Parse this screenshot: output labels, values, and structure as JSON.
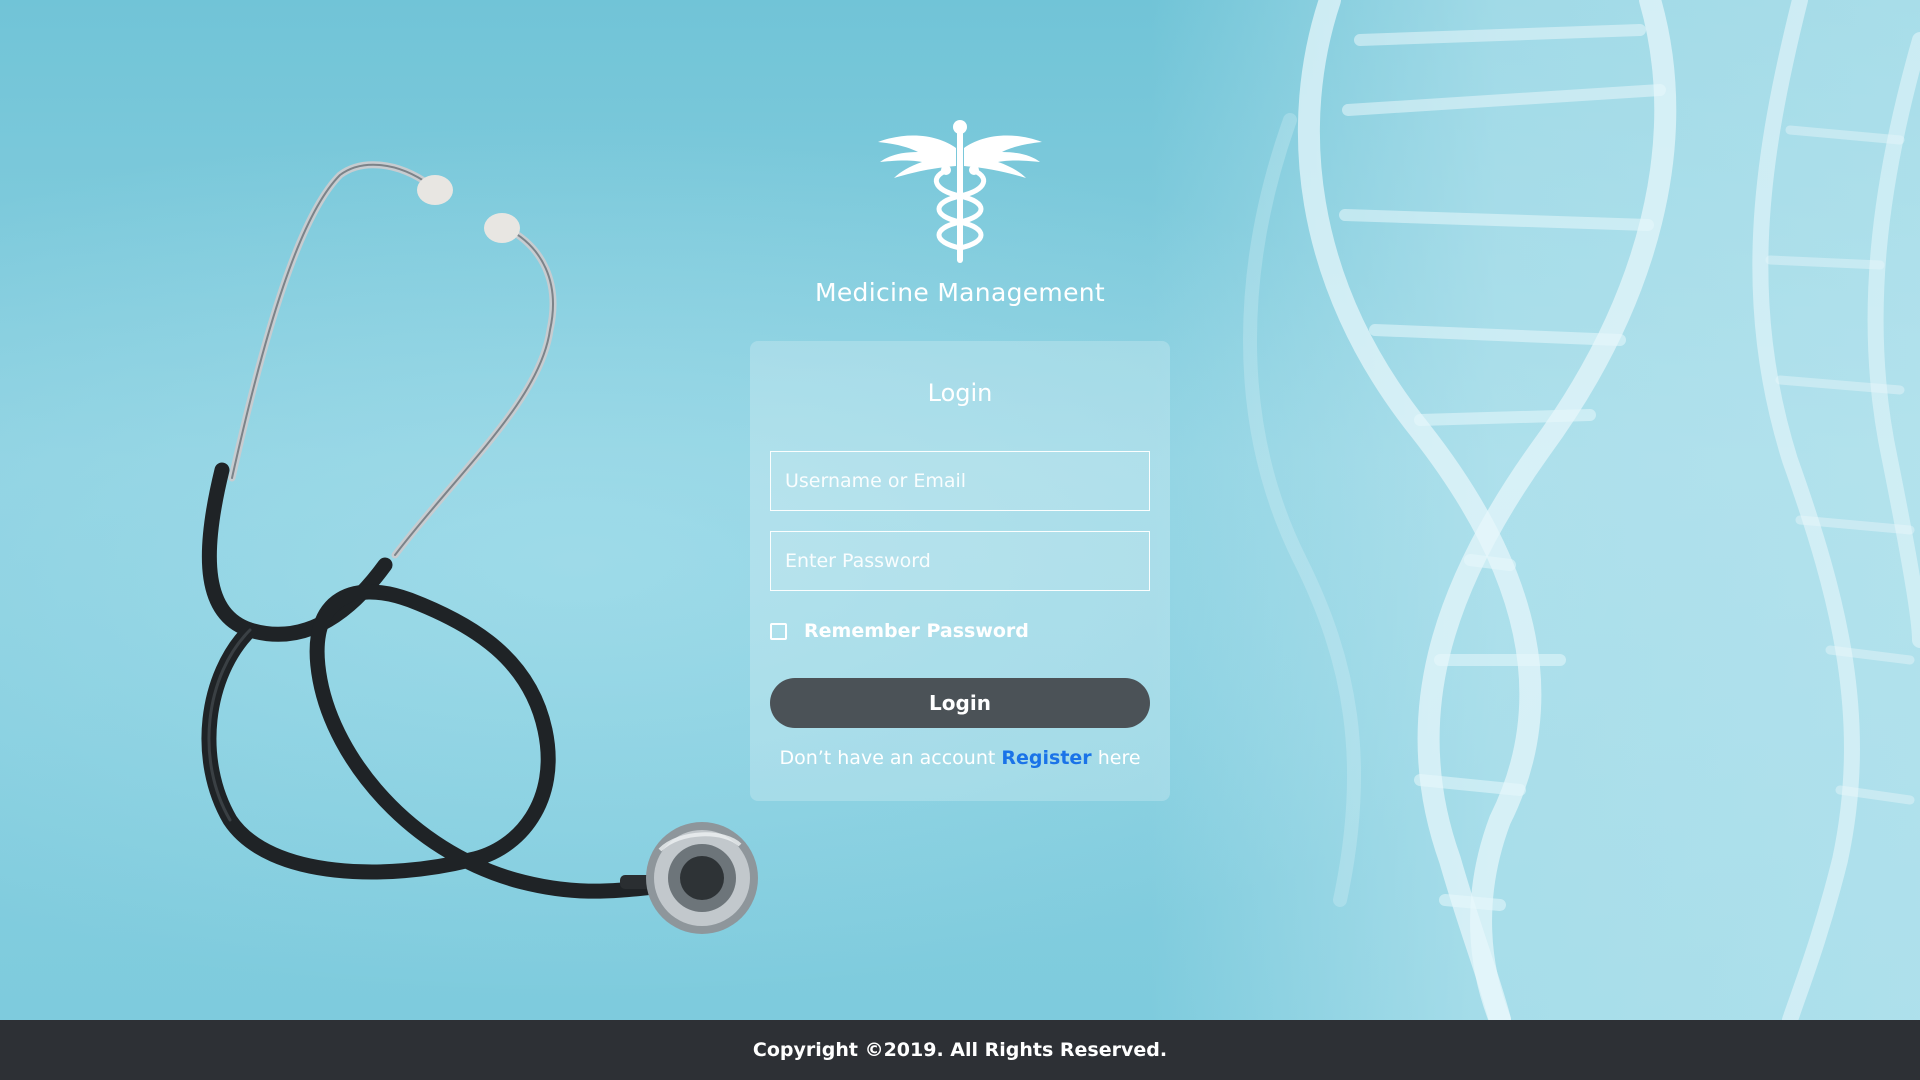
{
  "brand": {
    "title": "Medicine Management",
    "logo_icon": "caduceus-icon"
  },
  "login_form": {
    "title": "Login",
    "username_placeholder": "Username or Email",
    "password_placeholder": "Enter Password",
    "remember_label": "Remember Password",
    "remember_checked": false,
    "submit_label": "Login",
    "register_prefix": "Don’t have an account",
    "register_link": "Register",
    "register_suffix": "here"
  },
  "footer": {
    "copyright": "Copyright ©2019. All Rights Reserved."
  },
  "colors": {
    "background": "#7ecbdd",
    "button": "#4b5257",
    "link": "#1a73e8",
    "footer": "#2d3035"
  },
  "background_imagery": [
    "stethoscope",
    "dna-double-helix"
  ]
}
